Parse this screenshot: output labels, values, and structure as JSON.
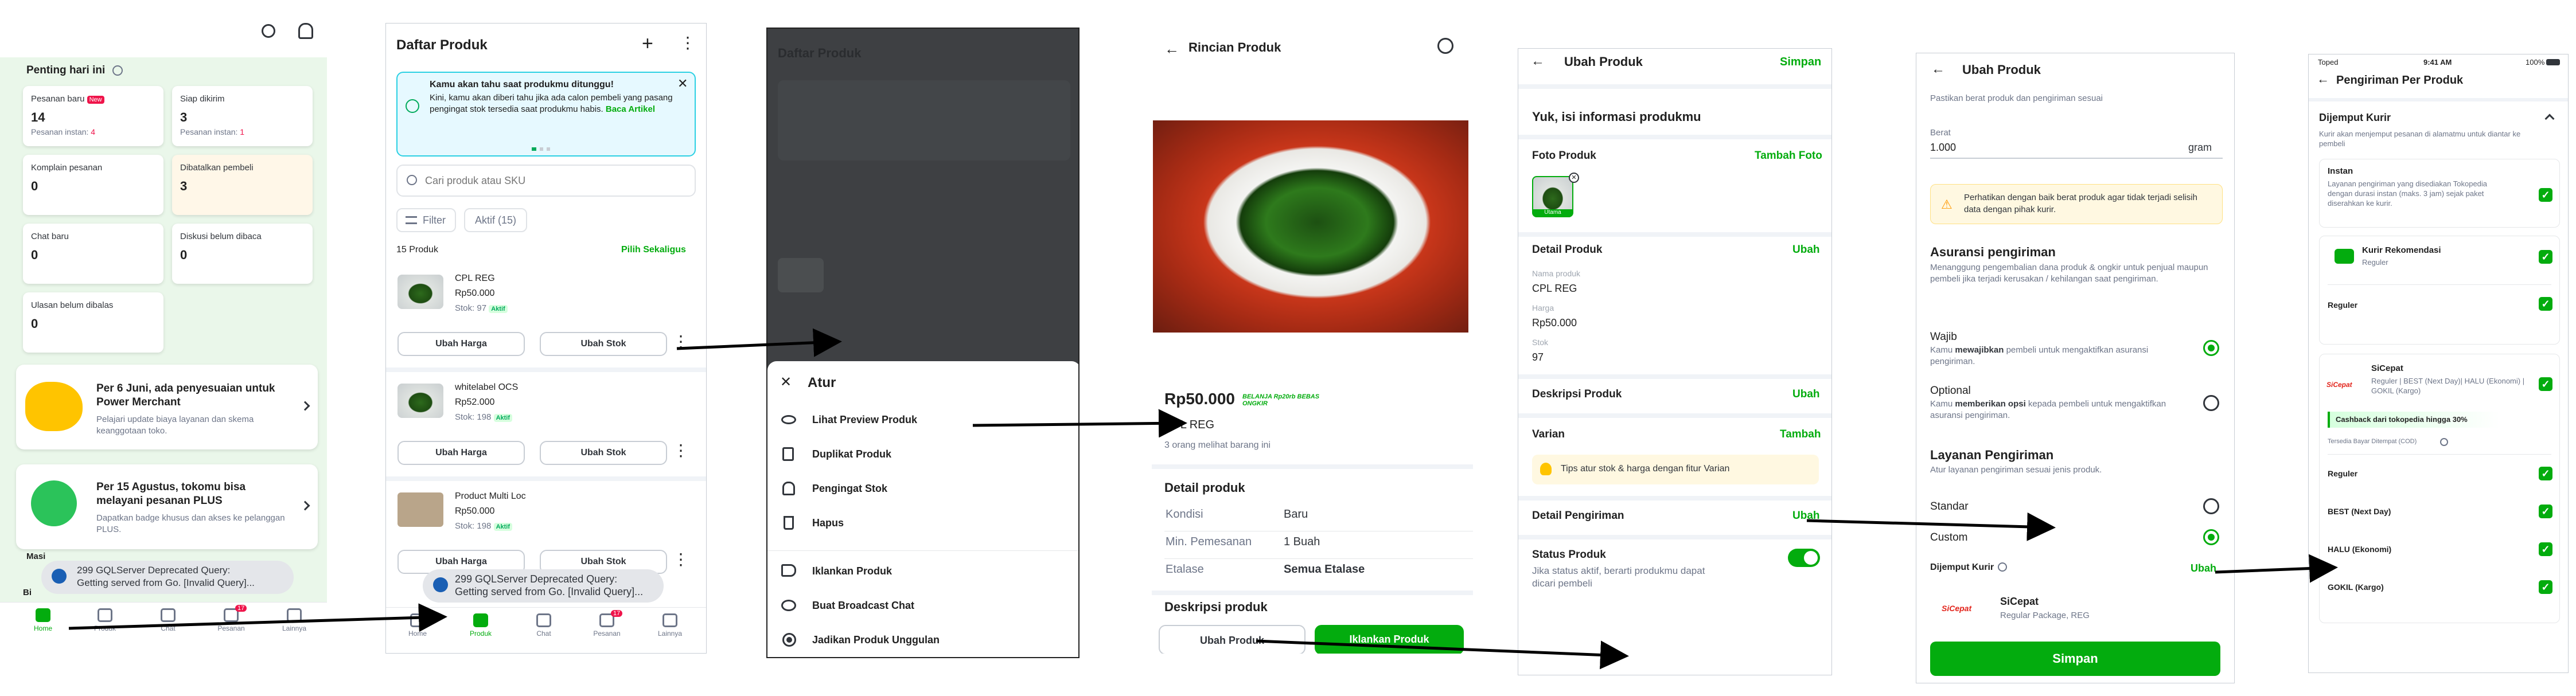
{
  "s1": {
    "section_title": "Penting hari ini",
    "cards": [
      {
        "label": "Pesanan baru",
        "badge": "New",
        "value": "14",
        "sub": "Pesanan instan: ",
        "sub_n": "4"
      },
      {
        "label": "Siap dikirim",
        "value": "3",
        "sub": "Pesanan instan: ",
        "sub_n": "1"
      },
      {
        "label": "Komplain pesanan",
        "value": "0"
      },
      {
        "label": "Dibatalkan pembeli",
        "value": "3"
      },
      {
        "label": "Chat baru",
        "value": "0"
      },
      {
        "label": "Diskusi belum dibaca",
        "value": "0"
      },
      {
        "label": "Ulasan belum dibalas",
        "value": "0"
      }
    ],
    "promos": [
      {
        "title": "Per 6 Juni, ada penyesuaian untuk Power Merchant",
        "desc": "Pelajari update biaya layanan dan skema keanggotaan toko."
      },
      {
        "title": "Per 15 Agustus, tokomu bisa melayani pesanan PLUS",
        "desc": "Dapatkan badge khusus dan akses ke pelanggan PLUS."
      }
    ],
    "partial_text": "Masi",
    "partial_text_2": "Bi",
    "toast_line1": "299 GQLServer Deprecated Query:",
    "toast_line2": "Getting served from Go. [Invalid Query]...",
    "nav": [
      "Home",
      "Produk",
      "Chat",
      "Pesanan",
      "Lainnya"
    ],
    "nav_badge": "17"
  },
  "s2": {
    "title": "Daftar Produk",
    "info_title": "Kamu akan tahu saat produkmu ditunggu!",
    "info_body": "Kini, kamu akan diberi tahu jika ada calon pembeli yang pasang pengingat stok tersedia saat produkmu habis.",
    "info_link": "Baca Artikel",
    "search_placeholder": "Cari produk atau SKU",
    "filter": "Filter",
    "chip": "Aktif (15)",
    "count": "15 Produk",
    "select_all": "Pilih Sekaligus",
    "products": [
      {
        "name": "CPL REG",
        "price": "Rp50.000",
        "stock": "Stok: 97",
        "tag": "Aktif"
      },
      {
        "name": "whitelabel OCS",
        "price": "Rp52.000",
        "stock": "Stok: 198",
        "tag": "Aktif"
      },
      {
        "name": "Product Multi Loc",
        "price": "Rp50.000",
        "stock": "Stok: 198",
        "tag": "Aktif"
      }
    ],
    "btn_price": "Ubah Harga",
    "btn_stock": "Ubah Stok",
    "toast_line1": "299 GQLServer Deprecated Query:",
    "toast_line2": "Getting served from Go. [Invalid Query]...",
    "nav": [
      "Home",
      "Produk",
      "Chat",
      "Pesanan",
      "Lainnya"
    ],
    "nav_badge": "17"
  },
  "s3": {
    "bg_title": "Daftar Produk",
    "sheet_title": "Atur",
    "items": [
      "Lihat Preview Produk",
      "Duplikat Produk",
      "Pengingat Stok",
      "Hapus",
      "Iklankan Produk",
      "Buat Broadcast Chat",
      "Jadikan Produk Unggulan"
    ]
  },
  "s4": {
    "title": "Rincian Produk",
    "price": "Rp50.000",
    "promo": "BELANJA Rp20rb BEBAS ONGKIR",
    "name": "CPL REG",
    "views": "3 orang melihat barang ini",
    "detail_title": "Detail produk",
    "rows": [
      {
        "k": "Kondisi",
        "v": "Baru"
      },
      {
        "k": "Min. Pemesanan",
        "v": "1 Buah"
      },
      {
        "k": "Etalase",
        "v": "Semua Etalase"
      }
    ],
    "desc_title": "Deskripsi produk",
    "btn_edit": "Ubah Produk",
    "btn_ads": "Iklankan Produk"
  },
  "s5": {
    "title": "Ubah Produk",
    "save": "Simpan",
    "heading": "Yuk, isi informasi produkmu",
    "photo_label": "Foto Produk",
    "add_photo": "Tambah Foto",
    "photo_badge": "Utama",
    "detail_label": "Detail Produk",
    "edit": "Ubah",
    "fields": [
      {
        "label": "Nama produk",
        "value": "CPL REG"
      },
      {
        "label": "Harga",
        "value": "Rp50.000"
      },
      {
        "label": "Stok",
        "value": "97"
      }
    ],
    "desc_label": "Deskripsi Produk",
    "variant_label": "Varian",
    "variant_add": "Tambah",
    "variant_tip": "Tips atur stok & harga dengan fitur Varian",
    "shipping_label": "Detail Pengiriman",
    "status_label": "Status Produk",
    "status_desc": "Jika status aktif, berarti produkmu dapat dicari pembeli"
  },
  "s6": {
    "title": "Ubah Produk",
    "intro": "Pastikan berat produk dan pengiriman sesuai",
    "weight_label": "Berat",
    "weight_value": "1.000",
    "weight_unit": "gram",
    "warning": "Perhatikan dengan baik berat produk agar tidak terjadi selisih data dengan pihak kurir.",
    "insurance_title": "Asuransi pengiriman",
    "insurance_desc": "Menanggung pengembalian dana produk & ongkir untuk penjual maupun pembeli jika terjadi kerusakan / kehilangan saat pengiriman.",
    "opt1_title": "Wajib",
    "opt1_desc_pre": "Kamu ",
    "opt1_desc_b": "mewajibkan",
    "opt1_desc_post": " pembeli untuk mengaktifkan asuransi pengiriman.",
    "opt2_title": "Optional",
    "opt2_desc_pre": "Kamu ",
    "opt2_desc_b": "memberikan opsi",
    "opt2_desc_post": " kepada pembeli untuk mengaktifkan asuransi pengiriman.",
    "service_title": "Layanan Pengiriman",
    "service_desc": "Atur layanan pengiriman sesuai jenis produk.",
    "standard": "Standar",
    "custom": "Custom",
    "pickup": "Dijemput Kurir",
    "edit": "Ubah",
    "courier": "SiCepat",
    "courier_sub": "Regular Package, REG",
    "save": "Simpan"
  },
  "s7": {
    "status_left": "Toped",
    "time": "9:41 AM",
    "battery": "100%",
    "title": "Pengiriman Per Produk",
    "section": "Dijemput Kurir",
    "section_desc": "Kurir akan menjemput pesanan di alamatmu untuk diantar ke pembeli",
    "instant_title": "Instan",
    "instant_desc": "Layanan pengiriman yang disediakan Tokopedia dengan durasi instan (maks. 3 jam) sejak paket diserahkan ke kurir.",
    "rekom_title": "Kurir Rekomendasi",
    "rekom_sub": "Reguler",
    "reguler": "Reguler",
    "sicepat_title": "SiCepat",
    "sicepat_sub": "Reguler | BEST (Next Day)| HALU (Ekonomi) | GOKIL (Kargo)",
    "cashback": "Cashback dari tokopedia hingga 30%",
    "cod": "Tersedia Bayar Ditempat (COD)",
    "services": [
      "Reguler",
      "BEST (Next Day)",
      "HALU (Ekonomi)",
      "GOKIL (Kargo)"
    ]
  }
}
